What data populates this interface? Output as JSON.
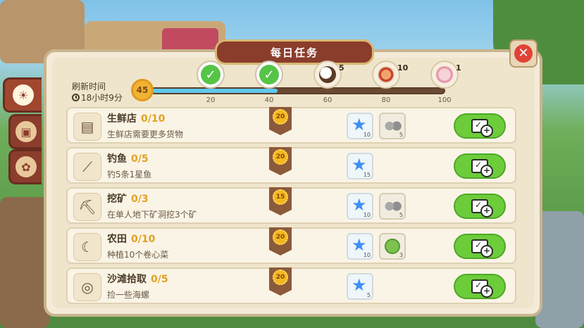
{
  "panel": {
    "title": "每日任务"
  },
  "refresh": {
    "label": "刷新时间",
    "time": "18小时9分"
  },
  "level": "45",
  "progress": {
    "value": 0.43,
    "ticks": [
      "20",
      "40",
      "60",
      "80",
      "100"
    ],
    "milestones": [
      {
        "kind": "check",
        "count": ""
      },
      {
        "kind": "check",
        "count": ""
      },
      {
        "kind": "coconut",
        "count": "5"
      },
      {
        "kind": "fish-dish",
        "count": "10"
      },
      {
        "kind": "ham",
        "count": "1"
      }
    ]
  },
  "tasks": [
    {
      "name": "生鲜店",
      "progress": "0/10",
      "desc": "生鲜店需要更多货物",
      "icon": "register-icon",
      "points": "20",
      "rewards": [
        {
          "icon": "star",
          "count": "10"
        },
        {
          "icon": "stone",
          "count": "5"
        }
      ]
    },
    {
      "name": "钓鱼",
      "progress": "0/5",
      "desc": "钓5条1星鱼",
      "icon": "fishing-rod-icon",
      "points": "20",
      "rewards": [
        {
          "icon": "star",
          "count": "15"
        }
      ]
    },
    {
      "name": "挖矿",
      "progress": "0/3",
      "desc": "在单人地下矿洞挖3个矿",
      "icon": "pickaxe-icon",
      "points": "15",
      "rewards": [
        {
          "icon": "star",
          "count": "10"
        },
        {
          "icon": "stone",
          "count": "5"
        }
      ]
    },
    {
      "name": "农田",
      "progress": "0/10",
      "desc": "种植10个卷心菜",
      "icon": "sickle-icon",
      "points": "20",
      "rewards": [
        {
          "icon": "star",
          "count": "10"
        },
        {
          "icon": "cabbage-seed",
          "count": "3"
        }
      ]
    },
    {
      "name": "沙滩拾取",
      "progress": "0/5",
      "desc": "捡一些海螺",
      "icon": "shell-icon",
      "points": "20",
      "rewards": [
        {
          "icon": "star",
          "count": "5"
        }
      ]
    }
  ],
  "colors": {
    "accent": "#8b3d2c",
    "progress": "#5fc8ee",
    "button": "#6ccc3a",
    "gold": "#e0a222"
  }
}
